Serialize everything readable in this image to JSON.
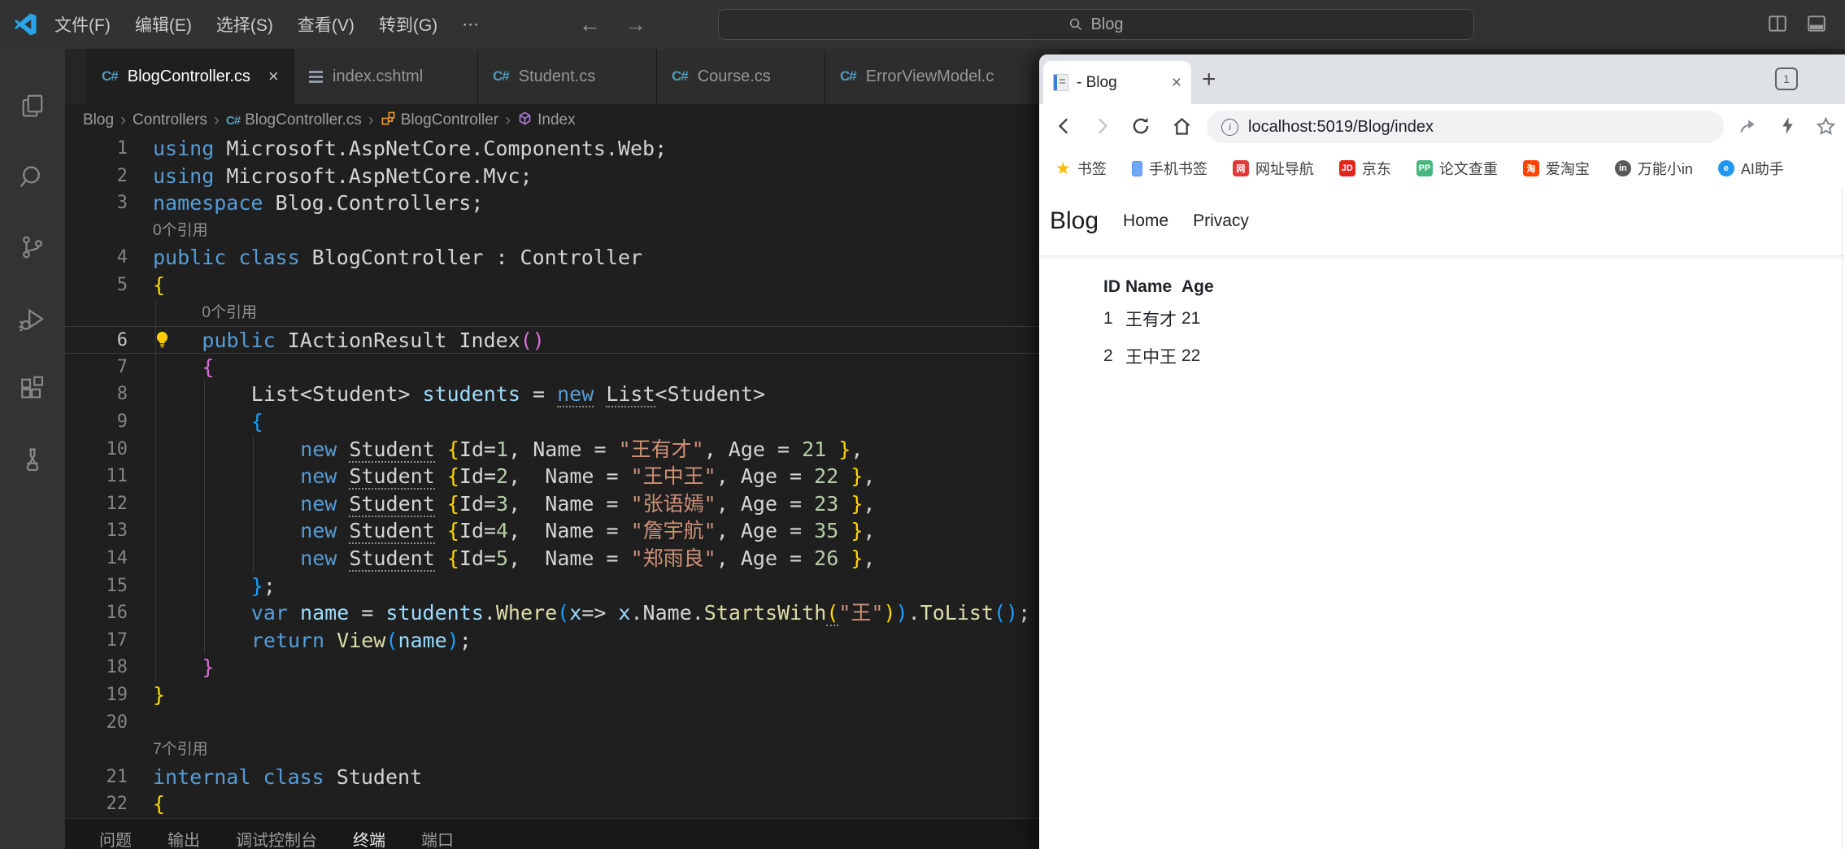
{
  "titlebar": {
    "menus": [
      "文件(F)",
      "编辑(E)",
      "选择(S)",
      "查看(V)",
      "转到(G)"
    ],
    "more": "···",
    "search": "Blog"
  },
  "activity_icons": [
    "explorer",
    "search",
    "source-control",
    "run-debug",
    "extensions",
    "testing"
  ],
  "editor_tabs": [
    {
      "label": "BlogController.cs",
      "icon": "csharp",
      "active": true
    },
    {
      "label": "index.cshtml",
      "icon": "cshtml",
      "active": false
    },
    {
      "label": "Student.cs",
      "icon": "csharp",
      "active": false
    },
    {
      "label": "Course.cs",
      "icon": "csharp",
      "active": false
    },
    {
      "label": "ErrorViewModel.c",
      "icon": "csharp",
      "active": false
    }
  ],
  "breadcrumb": [
    {
      "label": "Blog",
      "icon": ""
    },
    {
      "label": "Controllers",
      "icon": ""
    },
    {
      "label": "BlogController.cs",
      "icon": "csharp"
    },
    {
      "label": "BlogController",
      "icon": "class"
    },
    {
      "label": "Index",
      "icon": "method"
    }
  ],
  "code_rows": [
    {
      "n": "1",
      "ind": 0,
      "t": [
        [
          "using ",
          "kw"
        ],
        [
          "Microsoft.AspNetCore.Components.Web;",
          "pln"
        ]
      ]
    },
    {
      "n": "2",
      "ind": 0,
      "t": [
        [
          "using ",
          "kw"
        ],
        [
          "Microsoft.AspNetCore.Mvc;",
          "pln"
        ]
      ]
    },
    {
      "n": "3",
      "ind": 0,
      "t": [
        [
          "namespace ",
          "kw"
        ],
        [
          "Blog.Controllers;",
          "pln"
        ]
      ]
    },
    {
      "lens": "0个引用",
      "ind": 0
    },
    {
      "n": "4",
      "ind": 0,
      "t": [
        [
          "public class ",
          "kw"
        ],
        [
          "BlogController : Controller",
          "pln"
        ]
      ]
    },
    {
      "n": "5",
      "ind": 0,
      "t": [
        [
          "{",
          "b1"
        ]
      ]
    },
    {
      "lens": "0个引用",
      "ind": 1
    },
    {
      "n": "6",
      "ind": 1,
      "cur": true,
      "bulb": true,
      "t": [
        [
          "public ",
          "kw"
        ],
        [
          "IActionResult Index",
          "pln"
        ],
        [
          "()",
          "b2"
        ]
      ]
    },
    {
      "n": "7",
      "ind": 1,
      "t": [
        [
          "{",
          "b2"
        ]
      ]
    },
    {
      "n": "8",
      "ind": 2,
      "t": [
        [
          "List<Student> ",
          "pln"
        ],
        [
          "students",
          "var"
        ],
        [
          " = ",
          "pln"
        ],
        [
          "new",
          "kw h"
        ],
        [
          " ",
          "pln"
        ],
        [
          "List",
          "pln h"
        ],
        [
          "<Student>",
          "pln"
        ]
      ]
    },
    {
      "n": "9",
      "ind": 2,
      "t": [
        [
          "{",
          "b3"
        ]
      ]
    },
    {
      "n": "10",
      "ind": 3,
      "t": [
        [
          "new",
          "kw"
        ],
        [
          " ",
          "pln"
        ],
        [
          "Student",
          "pln h"
        ],
        [
          " ",
          "pln"
        ],
        [
          "{",
          "b1"
        ],
        [
          "Id=",
          "pln"
        ],
        [
          "1",
          "num"
        ],
        [
          ", Name = ",
          "pln"
        ],
        [
          "\"王有才\"",
          "str"
        ],
        [
          ", Age = ",
          "pln"
        ],
        [
          "21",
          "num"
        ],
        [
          " ",
          "pln"
        ],
        [
          "}",
          "b1"
        ],
        [
          ",",
          "pln"
        ]
      ]
    },
    {
      "n": "11",
      "ind": 3,
      "t": [
        [
          "new",
          "kw"
        ],
        [
          " ",
          "pln"
        ],
        [
          "Student",
          "pln h"
        ],
        [
          " ",
          "pln"
        ],
        [
          "{",
          "b1"
        ],
        [
          "Id=",
          "pln"
        ],
        [
          "2",
          "num"
        ],
        [
          ",  Name = ",
          "pln"
        ],
        [
          "\"王中王\"",
          "str"
        ],
        [
          ", Age = ",
          "pln"
        ],
        [
          "22",
          "num"
        ],
        [
          " ",
          "pln"
        ],
        [
          "}",
          "b1"
        ],
        [
          ",",
          "pln"
        ]
      ]
    },
    {
      "n": "12",
      "ind": 3,
      "t": [
        [
          "new",
          "kw"
        ],
        [
          " ",
          "pln"
        ],
        [
          "Student",
          "pln h"
        ],
        [
          " ",
          "pln"
        ],
        [
          "{",
          "b1"
        ],
        [
          "Id=",
          "pln"
        ],
        [
          "3",
          "num"
        ],
        [
          ",  Name = ",
          "pln"
        ],
        [
          "\"张语嫣\"",
          "str"
        ],
        [
          ", Age = ",
          "pln"
        ],
        [
          "23",
          "num"
        ],
        [
          " ",
          "pln"
        ],
        [
          "}",
          "b1"
        ],
        [
          ",",
          "pln"
        ]
      ]
    },
    {
      "n": "13",
      "ind": 3,
      "t": [
        [
          "new",
          "kw"
        ],
        [
          " ",
          "pln"
        ],
        [
          "Student",
          "pln h"
        ],
        [
          " ",
          "pln"
        ],
        [
          "{",
          "b1"
        ],
        [
          "Id=",
          "pln"
        ],
        [
          "4",
          "num"
        ],
        [
          ",  Name = ",
          "pln"
        ],
        [
          "\"詹宇航\"",
          "str"
        ],
        [
          ", Age = ",
          "pln"
        ],
        [
          "35",
          "num"
        ],
        [
          " ",
          "pln"
        ],
        [
          "}",
          "b1"
        ],
        [
          ",",
          "pln"
        ]
      ]
    },
    {
      "n": "14",
      "ind": 3,
      "t": [
        [
          "new",
          "kw"
        ],
        [
          " ",
          "pln"
        ],
        [
          "Student",
          "pln h"
        ],
        [
          " ",
          "pln"
        ],
        [
          "{",
          "b1"
        ],
        [
          "Id=",
          "pln"
        ],
        [
          "5",
          "num"
        ],
        [
          ",  Name = ",
          "pln"
        ],
        [
          "\"郑雨良\"",
          "str"
        ],
        [
          ", Age = ",
          "pln"
        ],
        [
          "26",
          "num"
        ],
        [
          " ",
          "pln"
        ],
        [
          "}",
          "b1"
        ],
        [
          ",",
          "pln"
        ]
      ]
    },
    {
      "n": "15",
      "ind": 2,
      "t": [
        [
          "}",
          "b3"
        ],
        [
          ";",
          "pln"
        ]
      ]
    },
    {
      "n": "16",
      "ind": 2,
      "t": [
        [
          "var",
          "kw"
        ],
        [
          " ",
          "pln"
        ],
        [
          "name",
          "var"
        ],
        [
          " = ",
          "pln"
        ],
        [
          "students",
          "var"
        ],
        [
          ".",
          "pln"
        ],
        [
          "Where",
          "fn"
        ],
        [
          "(",
          "b3"
        ],
        [
          "x",
          "var"
        ],
        [
          "=> ",
          "pln"
        ],
        [
          "x",
          "var"
        ],
        [
          ".Name.",
          "pln"
        ],
        [
          "StartsWith",
          "fn"
        ],
        [
          "(",
          "b1 h"
        ],
        [
          "\"王\"",
          "str"
        ],
        [
          ")",
          "b1"
        ],
        [
          ")",
          "b3"
        ],
        [
          ".",
          "pln"
        ],
        [
          "ToList",
          "fn"
        ],
        [
          "()",
          "b3"
        ],
        [
          ";",
          "pln"
        ]
      ]
    },
    {
      "n": "17",
      "ind": 2,
      "t": [
        [
          "return ",
          "kw"
        ],
        [
          "View",
          "fn"
        ],
        [
          "(",
          "b3"
        ],
        [
          "name",
          "var"
        ],
        [
          ")",
          "b3"
        ],
        [
          ";",
          "pln"
        ]
      ]
    },
    {
      "n": "18",
      "ind": 1,
      "t": [
        [
          "}",
          "b2"
        ]
      ]
    },
    {
      "n": "19",
      "ind": 0,
      "t": [
        [
          "}",
          "b1"
        ]
      ]
    },
    {
      "n": "20",
      "ind": 0,
      "t": []
    },
    {
      "lens": "7个引用",
      "ind": 0
    },
    {
      "n": "21",
      "ind": 0,
      "t": [
        [
          "internal class ",
          "kw"
        ],
        [
          "Student",
          "pln"
        ]
      ]
    },
    {
      "n": "22",
      "ind": 0,
      "t": [
        [
          "{",
          "b1"
        ]
      ]
    }
  ],
  "panel_tabs": [
    {
      "label": "问题",
      "active": false
    },
    {
      "label": "输出",
      "active": false
    },
    {
      "label": "调试控制台",
      "active": false
    },
    {
      "label": "终端",
      "active": true
    },
    {
      "label": "端口",
      "active": false
    }
  ],
  "browser": {
    "tab_title": "- Blog",
    "tab_count": "1",
    "url": "localhost:5019/Blog/index",
    "bookmarks": [
      {
        "label": "书签",
        "icon": "star",
        "glyph": "★",
        "color": "#fbbc04"
      },
      {
        "label": "手机书签",
        "icon": "phone",
        "glyph": "",
        "color": "#6fa8f5"
      },
      {
        "label": "网址导航",
        "icon": "square",
        "glyph": "网",
        "color": "#e13a3a"
      },
      {
        "label": "京东",
        "icon": "square",
        "glyph": "JD",
        "color": "#e1251b"
      },
      {
        "label": "论文查重",
        "icon": "square",
        "glyph": "PP",
        "color": "#45b97c"
      },
      {
        "label": "爱淘宝",
        "icon": "square",
        "glyph": "淘",
        "color": "#ff4200"
      },
      {
        "label": "万能小in",
        "icon": "circle",
        "glyph": "in",
        "color": "#595959"
      },
      {
        "label": "AI助手",
        "icon": "circle",
        "glyph": "e",
        "color": "#2196f3"
      }
    ],
    "page": {
      "brand": "Blog",
      "nav_links": [
        "Home",
        "Privacy"
      ],
      "table": {
        "headers": [
          "ID",
          "Name",
          "Age"
        ],
        "rows": [
          [
            "1",
            "王有才",
            "21"
          ],
          [
            "2",
            "王中王",
            "22"
          ]
        ]
      }
    }
  },
  "accent_colors": {
    "keyword_blue": "#569CD6",
    "string_salmon": "#CE9178",
    "number_green": "#B5CEA8",
    "bracket_yellow": "#FFD700",
    "bracket_pink": "#DA70D6",
    "bracket_blue": "#179FFF",
    "csharp_icon_blue": "#519ABA",
    "lightbulb_yellow": "#FFCC00",
    "tabstrip_gray": "#DEE1E6"
  }
}
